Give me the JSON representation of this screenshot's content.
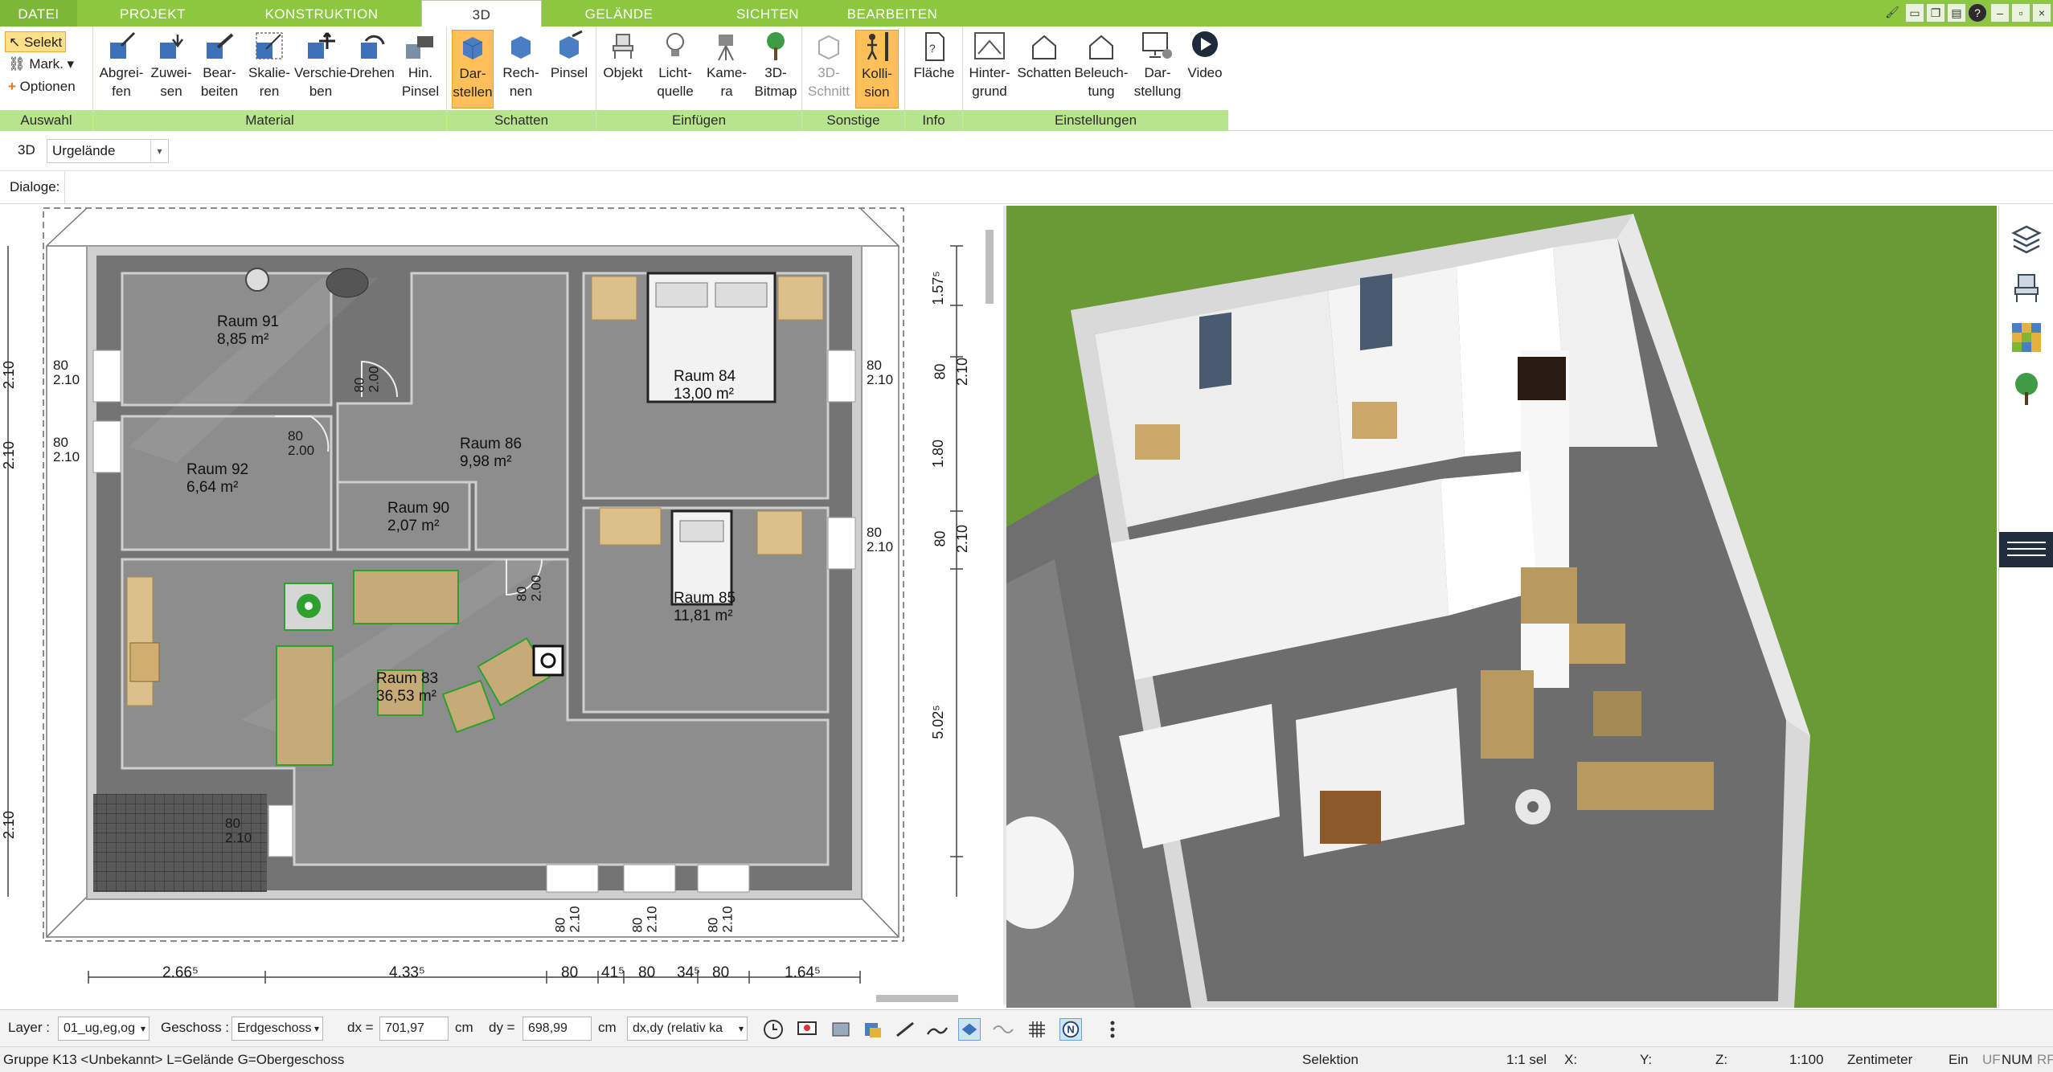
{
  "tabs": [
    "DATEI",
    "PROJEKT",
    "KONSTRUKTION",
    "3D",
    "GELÄNDE",
    "SICHTEN",
    "BEARBEITEN"
  ],
  "ribbon": {
    "auswahl": {
      "label": "Auswahl",
      "selekt": "Selekt",
      "mark": "Mark.",
      "optionen": "Optionen"
    },
    "material": {
      "label": "Material",
      "buttons": [
        "Abgrei-\nfen",
        "Zuwei-\nsen",
        "Bear-\nbeiten",
        "Skalie-\nren",
        "Verschie-\nben",
        "Drehen",
        "Hin.\nPinsel"
      ]
    },
    "schatten": {
      "label": "Schatten",
      "buttons": [
        "Dar-\nstellen",
        "Rech-\nnen",
        "Pinsel"
      ]
    },
    "einfuegen": {
      "label": "Einfügen",
      "buttons": [
        "Objekt",
        "Licht-\nquelle",
        "Kame-\nra",
        "3D-\nBitmap"
      ]
    },
    "sonstige": {
      "label": "Sonstige",
      "buttons": [
        "3D-\nSchnitt",
        "Kolli-\nsion"
      ]
    },
    "info": {
      "label": "Info",
      "buttons": [
        "Fläche"
      ]
    },
    "einstellungen": {
      "label": "Einstellungen",
      "buttons": [
        "Hinter-\ngrund",
        "Schatten",
        "Beleuch-\ntung",
        "Dar-\nstellung",
        "Video"
      ]
    }
  },
  "toolbar": {
    "view": "3D",
    "terrain": "Urgelände",
    "dialoge": "Dialoge:"
  },
  "rooms": [
    {
      "name": "Raum 91",
      "area": "8,85 m²"
    },
    {
      "name": "Raum 92",
      "area": "6,64 m²"
    },
    {
      "name": "Raum 86",
      "area": "9,98 m²"
    },
    {
      "name": "Raum 90",
      "area": "2,07 m²"
    },
    {
      "name": "Raum 84",
      "area": "13,00 m²"
    },
    {
      "name": "Raum 85",
      "area": "11,81 m²"
    },
    {
      "name": "Raum 83",
      "area": "36,53 m²"
    }
  ],
  "dims": {
    "bottom": [
      "2.66⁵",
      "4.33⁵",
      "80",
      "41⁵",
      "80",
      "34⁵",
      "80",
      "1.64⁵"
    ],
    "right": [
      "1.57⁵",
      "80",
      "2.10",
      "1.80",
      "80",
      "2.10",
      "5.02⁵"
    ],
    "left": [
      "2.10",
      "2.10",
      "2.10"
    ],
    "opening_w": "80",
    "opening_h": "2.10",
    "door_h": "2.00"
  },
  "bottombar": {
    "layer_label": "Layer :",
    "layer_value": "01_ug,eg,og",
    "geschoss_label": "Geschoss :",
    "geschoss_value": "Erdgeschoss",
    "dx_label": "dx =",
    "dx_value": "701,97",
    "dx_unit": "cm",
    "dy_label": "dy =",
    "dy_value": "698,99",
    "dy_unit": "cm",
    "mode_value": "dx,dy (relativ ka"
  },
  "status": {
    "group": "Gruppe K13 <Unbekannt> L=Gelände G=Obergeschoss",
    "mode": "Selektion",
    "sel": "1:1 sel",
    "x": "X:",
    "y": "Y:",
    "z": "Z:",
    "scale": "1:100",
    "unit": "Zentimeter",
    "ein": "Ein",
    "uf": "UF",
    "num": "NUM",
    "rf": "RF"
  },
  "colors": {
    "green": "#8dc63f",
    "group_bar": "#b7e48d",
    "active_button": "#ffc05a"
  }
}
